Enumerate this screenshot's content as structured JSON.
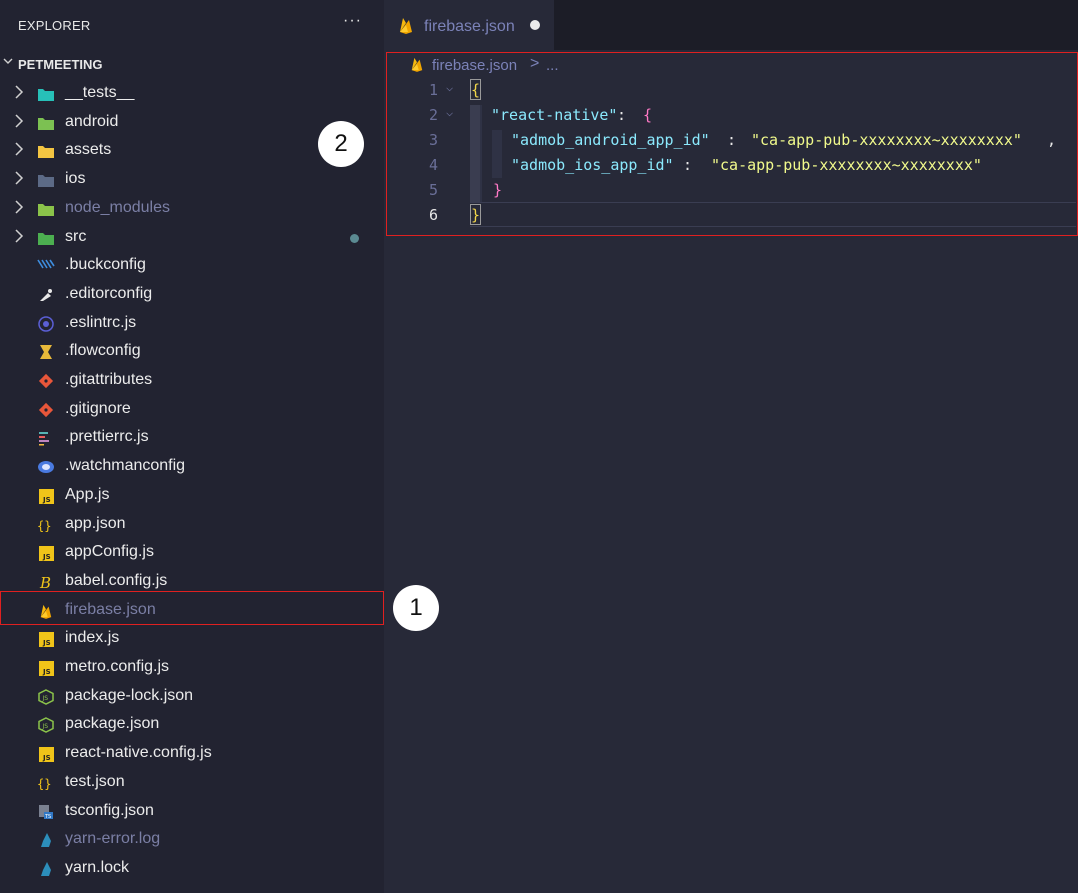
{
  "explorer": {
    "title": "EXPLORER",
    "more": "···",
    "project": "PETMEETING",
    "items": [
      {
        "name": "__tests__",
        "type": "folder",
        "icon": "tests-folder-icon",
        "color": "#27c0b8",
        "modified": false,
        "dim": false
      },
      {
        "name": "android",
        "type": "folder",
        "icon": "android-folder-icon",
        "color": "#7cc152",
        "modified": false,
        "dim": false
      },
      {
        "name": "assets",
        "type": "folder",
        "icon": "assets-folder-icon",
        "color": "#f4c542",
        "modified": false,
        "dim": false
      },
      {
        "name": "ios",
        "type": "folder",
        "icon": "ios-folder-icon",
        "color": "#5c6a86",
        "modified": false,
        "dim": false
      },
      {
        "name": "node_modules",
        "type": "folder",
        "icon": "node-modules-folder-icon",
        "color": "#8bc34a",
        "modified": false,
        "dim": true
      },
      {
        "name": "src",
        "type": "folder",
        "icon": "src-folder-icon",
        "color": "#4caf50",
        "modified": true,
        "dim": false
      },
      {
        "name": ".buckconfig",
        "type": "file",
        "icon": "buck-icon",
        "color": "#3e8ee0",
        "dim": false
      },
      {
        "name": ".editorconfig",
        "type": "file",
        "icon": "editorconfig-icon",
        "color": "#e8e8e8",
        "dim": false
      },
      {
        "name": ".eslintrc.js",
        "type": "file",
        "icon": "eslint-icon",
        "color": "#5b5fd6",
        "dim": false
      },
      {
        "name": ".flowconfig",
        "type": "file",
        "icon": "flow-icon",
        "color": "#e8b93a",
        "dim": false
      },
      {
        "name": ".gitattributes",
        "type": "file",
        "icon": "git-icon",
        "color": "#e8563a",
        "dim": false
      },
      {
        "name": ".gitignore",
        "type": "file",
        "icon": "git-icon",
        "color": "#e8563a",
        "dim": false
      },
      {
        "name": ".prettierrc.js",
        "type": "file",
        "icon": "prettier-icon",
        "color": "#9aa4b8",
        "dim": false
      },
      {
        "name": ".watchmanconfig",
        "type": "file",
        "icon": "watchman-icon",
        "color": "#4a7ae0",
        "dim": false
      },
      {
        "name": "App.js",
        "type": "file",
        "icon": "js-icon",
        "color": "#f0c419",
        "dim": false
      },
      {
        "name": "app.json",
        "type": "file",
        "icon": "json-icon",
        "color": "#f0c419",
        "dim": false
      },
      {
        "name": "appConfig.js",
        "type": "file",
        "icon": "js-icon",
        "color": "#f0c419",
        "dim": false
      },
      {
        "name": "babel.config.js",
        "type": "file",
        "icon": "babel-icon",
        "color": "#f0c419",
        "dim": false
      },
      {
        "name": "firebase.json",
        "type": "file",
        "icon": "firebase-icon",
        "color": "#f5b80f",
        "dim": true,
        "selected": true
      },
      {
        "name": "index.js",
        "type": "file",
        "icon": "js-icon",
        "color": "#f0c419",
        "dim": false
      },
      {
        "name": "metro.config.js",
        "type": "file",
        "icon": "js-icon",
        "color": "#f0c419",
        "dim": false
      },
      {
        "name": "package-lock.json",
        "type": "file",
        "icon": "npm-icon",
        "color": "#8bc34a",
        "dim": false
      },
      {
        "name": "package.json",
        "type": "file",
        "icon": "npm-icon",
        "color": "#8bc34a",
        "dim": false
      },
      {
        "name": "react-native.config.js",
        "type": "file",
        "icon": "js-icon",
        "color": "#f0c419",
        "dim": false
      },
      {
        "name": "test.json",
        "type": "file",
        "icon": "json-icon",
        "color": "#f0c419",
        "dim": false
      },
      {
        "name": "tsconfig.json",
        "type": "file",
        "icon": "tsconfig-icon",
        "color": "#3178c6",
        "dim": false
      },
      {
        "name": "yarn-error.log",
        "type": "file",
        "icon": "yarn-icon",
        "color": "#2c8ebb",
        "dim": true
      },
      {
        "name": "yarn.lock",
        "type": "file",
        "icon": "yarn-icon",
        "color": "#2c8ebb",
        "dim": false
      }
    ]
  },
  "tab": {
    "label": "firebase.json",
    "icon": "firebase-icon",
    "unsaved": true
  },
  "breadcrumb": {
    "file": "firebase.json",
    "separator": ">",
    "rest": "..."
  },
  "code": {
    "lines": [
      {
        "n": "1"
      },
      {
        "n": "2"
      },
      {
        "n": "3"
      },
      {
        "n": "4"
      },
      {
        "n": "5"
      },
      {
        "n": "6"
      }
    ],
    "open_brace": "{",
    "key_react_native": "\"react-native\"",
    "colon": ":",
    "inner_open": "{",
    "key_android": "\"admob_android_app_id\"",
    "val_android": "\"ca-app-pub-xxxxxxxx~xxxxxxxx\"",
    "comma": ",",
    "key_ios": "\"admob_ios_app_id\"",
    "val_ios": "\"ca-app-pub-xxxxxxxx~xxxxxxxx\"",
    "inner_close": "}",
    "close_brace": "}"
  },
  "callouts": {
    "one": "1",
    "two": "2"
  },
  "colors": {
    "highlight_border": "#e02020",
    "string": "#f1fa8c",
    "key": "#8be9fd",
    "punct": "#ff79c6"
  }
}
